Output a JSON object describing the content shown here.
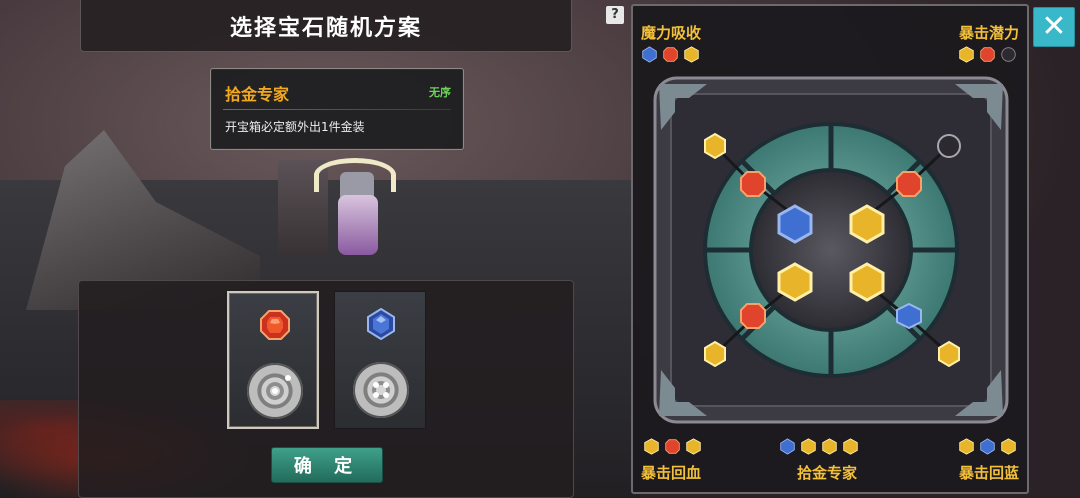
{
  "title": "选择宝石随机方案",
  "plan_card": {
    "name": "拾金专家",
    "tag": "无序",
    "description": "开宝箱必定额外出1件金装"
  },
  "slots": [
    {
      "gem": "red-gem-icon",
      "dial": "dial-three-dot-icon",
      "selected": true
    },
    {
      "gem": "blue-gem-icon",
      "dial": "dial-four-dot-icon",
      "selected": false
    }
  ],
  "confirm_label": "确 定",
  "help_label": "?",
  "close_label": "✕",
  "board": {
    "top_left": {
      "label": "魔力吸收",
      "gems": [
        "blue",
        "red",
        "gold"
      ]
    },
    "top_right": {
      "label": "暴击潜力",
      "gems": [
        "gold",
        "red",
        "black"
      ]
    },
    "bottom_left": {
      "label": "暴击回血",
      "gems": [
        "gold",
        "red",
        "gold"
      ]
    },
    "bottom_center": {
      "label": "拾金专家",
      "gems": [
        "blue",
        "gold",
        "gold",
        "gold"
      ]
    },
    "bottom_right": {
      "label": "暴击回蓝",
      "gems": [
        "gold",
        "blue",
        "gold"
      ]
    }
  },
  "colors": {
    "gold": "#e8b52a",
    "red": "#e0442c",
    "blue": "#3f6fd0",
    "black": "#2c2a30",
    "accent": "#38b8c9",
    "label": "#f3c03a"
  }
}
